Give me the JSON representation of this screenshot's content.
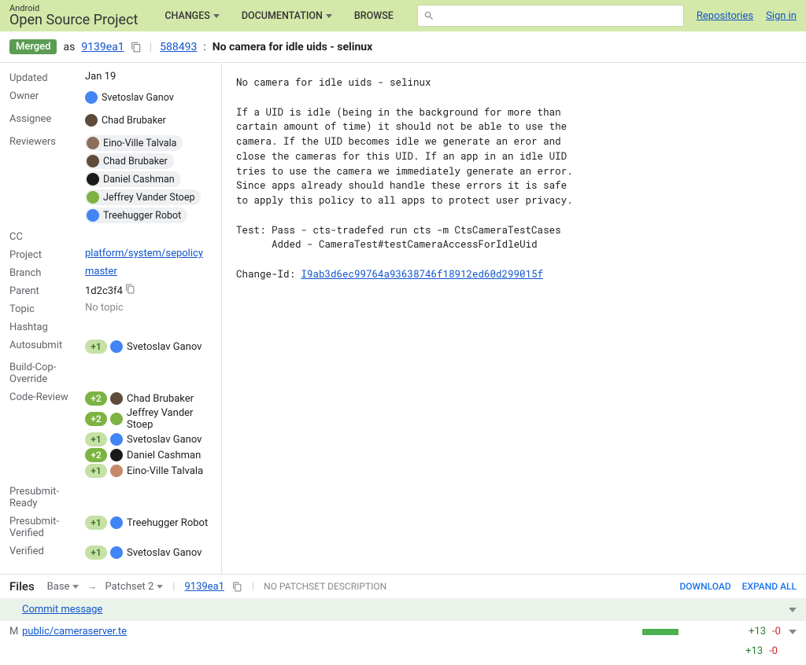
{
  "header": {
    "logo_small": "Android",
    "logo_big": "Open Source Project",
    "tabs": [
      "CHANGES",
      "DOCUMENTATION",
      "BROWSE"
    ],
    "search_placeholder": "",
    "links": {
      "repos": "Repositories",
      "signin": "Sign in"
    }
  },
  "sub": {
    "status": "Merged",
    "as": "as",
    "commit": "9139ea1",
    "change_num": "588493",
    "title": "No camera for idle uids - selinux"
  },
  "meta": {
    "updated_label": "Updated",
    "updated": "Jan 19",
    "owner_label": "Owner",
    "owner": "Svetoslav Ganov",
    "assignee_label": "Assignee",
    "assignee": "Chad Brubaker",
    "reviewers_label": "Reviewers",
    "reviewers": [
      "Eino-Ville Talvala",
      "Chad Brubaker",
      "Daniel Cashman",
      "Jeffrey Vander Stoep",
      "Treehugger Robot"
    ],
    "cc_label": "CC",
    "project_label": "Project",
    "project": "platform/system/sepolicy",
    "branch_label": "Branch",
    "branch": "master",
    "parent_label": "Parent",
    "parent": "1d2c3f4",
    "topic_label": "Topic",
    "topic": "No topic",
    "hashtag_label": "Hashtag",
    "autosubmit_label": "Autosubmit",
    "buildcop_label": "Build-Cop-Override",
    "codereview_label": "Code-Review",
    "presubmit_ready_label": "Presubmit-Ready",
    "presubmit_verified_label": "Presubmit-Verified",
    "verified_label": "Verified"
  },
  "votes": {
    "autosubmit": [
      {
        "score": "+1",
        "cls": "vote-1",
        "name": "Svetoslav Ganov",
        "av": "av1"
      }
    ],
    "codereview": [
      {
        "score": "+2",
        "cls": "vote-2",
        "name": "Chad Brubaker",
        "av": "av2"
      },
      {
        "score": "+2",
        "cls": "vote-2",
        "name": "Jeffrey Vander Stoep",
        "av": "av5"
      },
      {
        "score": "+1",
        "cls": "vote-1",
        "name": "Svetoslav Ganov",
        "av": "av1"
      },
      {
        "score": "+2",
        "cls": "vote-2",
        "name": "Daniel Cashman",
        "av": "av4"
      },
      {
        "score": "+1",
        "cls": "vote-1",
        "name": "Eino-Ville Talvala",
        "av": "av7"
      }
    ],
    "presubmit_verified": [
      {
        "score": "+1",
        "cls": "vote-1",
        "name": "Treehugger Robot",
        "av": "av6"
      }
    ],
    "verified": [
      {
        "score": "+1",
        "cls": "vote-1",
        "name": "Svetoslav Ganov",
        "av": "av1"
      }
    ]
  },
  "msg": {
    "title": "No camera for idle uids - selinux",
    "body": "If a UID is idle (being in the background for more than\ncartain amount of time) it should not be able to use the\ncamera. If the UID becomes idle we generate an eror and\nclose the cameras for this UID. If an app in an idle UID\ntries to use the camera we immediately generate an error.\nSince apps already should handle these errors it is safe\nto apply this policy to all apps to protect user privacy.",
    "test": "Test: Pass - cts-tradefed run cts -m CtsCameraTestCases\n      Added - CameraTest#testCameraAccessForIdleUid",
    "changeid_label": "Change-Id: ",
    "changeid": "I9ab3d6ec99764a93638746f18912ed60d299015f"
  },
  "files": {
    "title": "Files",
    "base": "Base",
    "patchset": "Patchset 2",
    "ps_link": "9139ea1",
    "nops": "NO PATCHSET DESCRIPTION",
    "download": "DOWNLOAD",
    "expand": "EXPAND ALL",
    "commit_link": "Commit message",
    "rows": [
      {
        "status": "M",
        "path": "public/cameraserver.te",
        "added": "+13",
        "removed": "-0"
      }
    ],
    "total_added": "+13",
    "total_removed": "-0"
  }
}
